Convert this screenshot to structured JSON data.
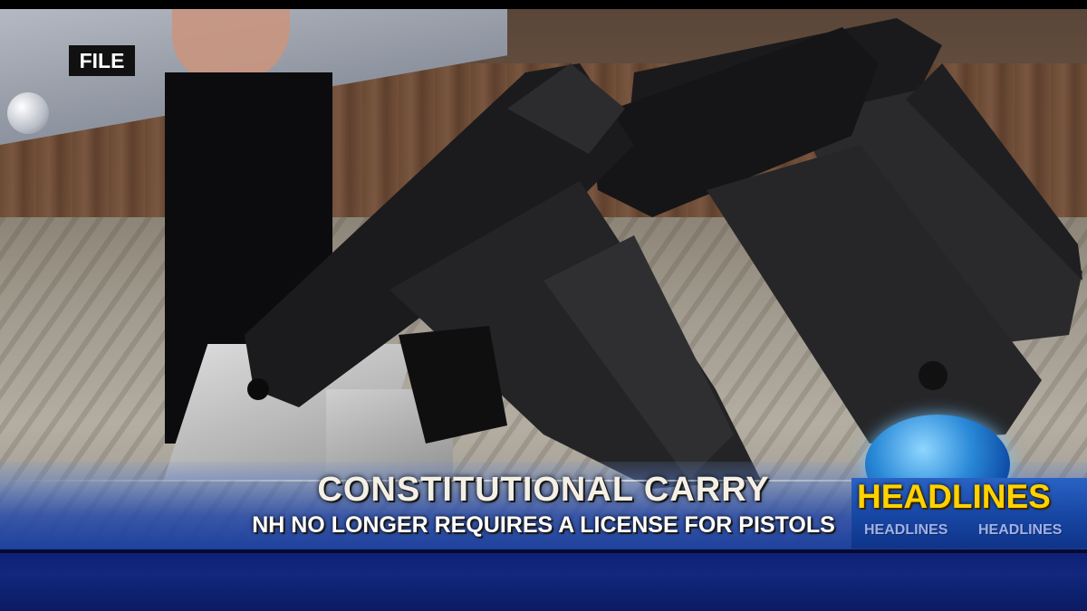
{
  "bug": {
    "label": "FILE"
  },
  "lower_third": {
    "headline": "CONSTITUTIONAL CARRY",
    "subheadline": "NH NO LONGER REQUIRES A LICENSE FOR PISTOLS"
  },
  "section_badge": {
    "title": "HEADLINES",
    "repeat": [
      "HEADLINES",
      "HEADLINES"
    ],
    "title_color": "#ffd200"
  },
  "colors": {
    "banner_blue": "#1b3f9c",
    "ticker_blue": "#12287e"
  }
}
